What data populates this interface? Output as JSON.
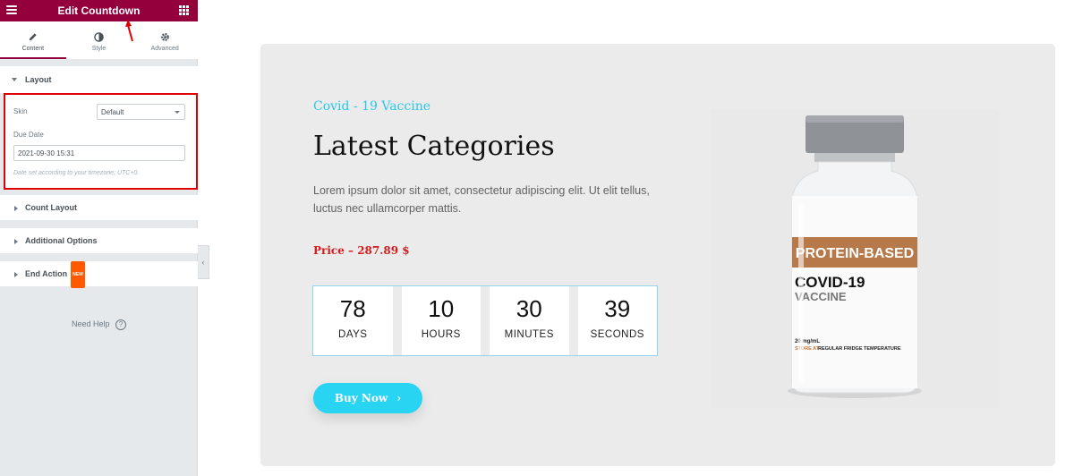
{
  "topbar": {
    "title": "Edit Countdown"
  },
  "tabs": [
    {
      "label": "Content"
    },
    {
      "label": "Style"
    },
    {
      "label": "Advanced"
    }
  ],
  "sections": {
    "layout": {
      "label": "Layout"
    },
    "count_layout": {
      "label": "Count Layout"
    },
    "additional_options": {
      "label": "Additional Options"
    },
    "end_action": {
      "label": "End Action",
      "badge": "NEW"
    }
  },
  "controls": {
    "skin_label": "Skin",
    "skin_value": "Default",
    "due_date_label": "Due Date",
    "due_date_value": "2021-09-30 15:31",
    "note": "Date set according to your timezone: UTC+0."
  },
  "help": {
    "label": "Need Help",
    "icon": "?"
  },
  "preview": {
    "subtitle": "Covid - 19 Vaccine",
    "heading": "Latest Categories",
    "description": "Lorem ipsum dolor sit amet, consectetur adipiscing elit. Ut elit tellus, luctus nec ullamcorper mattis.",
    "price": "Price – 287.89 $",
    "countdown": [
      {
        "value": "78",
        "label": "DAYS"
      },
      {
        "value": "10",
        "label": "HOURS"
      },
      {
        "value": "30",
        "label": "MINUTES"
      },
      {
        "value": "39",
        "label": "SECONDS"
      }
    ],
    "button": "Buy Now",
    "vial": {
      "band": "PROTEIN-BASED",
      "line1": "COVID-19",
      "line2": "VACCINE",
      "dose": "20 mg/mL",
      "storage_prefix": "STORE AT",
      "storage_text": "REGULAR FRIDGE TEMPERATURE"
    }
  },
  "colors": {
    "accent": "#93003c",
    "highlight": "#e00000",
    "cyan": "#29d3f2",
    "price": "#d21d1d"
  }
}
